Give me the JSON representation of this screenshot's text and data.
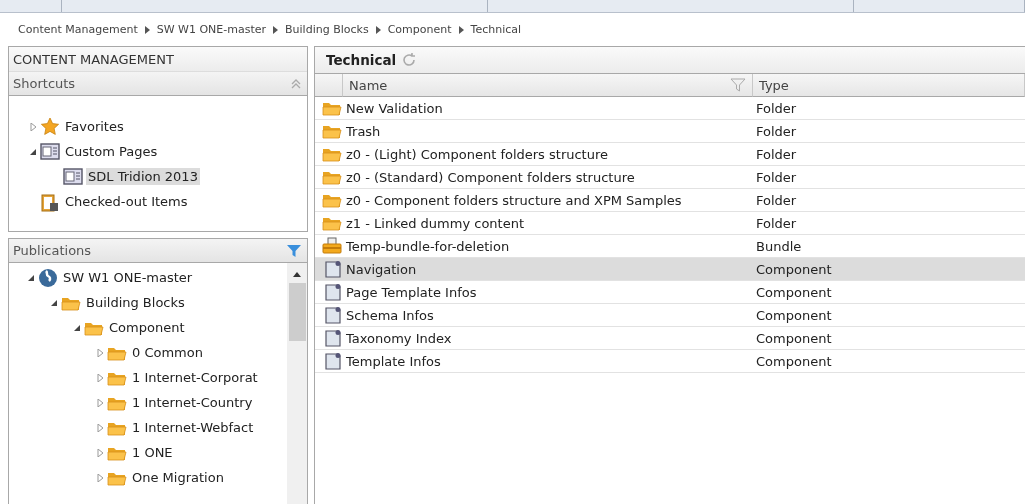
{
  "breadcrumb": [
    "Content Management",
    "SW W1 ONE-master",
    "Building Blocks",
    "Component",
    "Technical"
  ],
  "sidebar": {
    "title": "CONTENT MANAGEMENT",
    "shortcuts": {
      "title": "Shortcuts",
      "items": [
        {
          "label": "Favorites",
          "kind": "star",
          "expanded": false,
          "selected": false
        },
        {
          "label": "Custom Pages",
          "kind": "page",
          "expanded": true,
          "selected": false,
          "children": [
            {
              "label": "SDL Tridion 2013",
              "kind": "page",
              "selected": true
            }
          ]
        },
        {
          "label": "Checked-out Items",
          "kind": "checkout",
          "selected": false
        }
      ]
    },
    "publications": {
      "title": "Publications",
      "items": [
        {
          "label": "SW W1 ONE-master",
          "kind": "globe",
          "expanded": true,
          "children": [
            {
              "label": "Building Blocks",
              "kind": "folder",
              "expanded": true,
              "children": [
                {
                  "label": "Component",
                  "kind": "folder",
                  "expanded": true,
                  "children": [
                    {
                      "label": "0 Common",
                      "kind": "folder",
                      "expanded": false
                    },
                    {
                      "label": "1 Internet-Corporat",
                      "kind": "folder",
                      "expanded": false
                    },
                    {
                      "label": "1 Internet-Country",
                      "kind": "folder",
                      "expanded": false
                    },
                    {
                      "label": "1 Internet-Webfact",
                      "kind": "folder",
                      "expanded": false
                    },
                    {
                      "label": "1 ONE",
                      "kind": "folder",
                      "expanded": false
                    },
                    {
                      "label": "One Migration",
                      "kind": "folder",
                      "expanded": false
                    }
                  ]
                }
              ]
            }
          ]
        }
      ]
    }
  },
  "main": {
    "title": "Technical",
    "table": {
      "columns": [
        "Name",
        "Type"
      ],
      "rows": [
        {
          "kind": "folder",
          "name": "New Validation",
          "type": "Folder",
          "selected": false
        },
        {
          "kind": "folder",
          "name": "Trash",
          "type": "Folder",
          "selected": false
        },
        {
          "kind": "folder",
          "name": "z0 - (Light) Component folders structure",
          "type": "Folder",
          "selected": false
        },
        {
          "kind": "folder",
          "name": "z0 - (Standard) Component folders structure",
          "type": "Folder",
          "selected": false
        },
        {
          "kind": "folder",
          "name": "z0 - Component folders structure and XPM Samples",
          "type": "Folder",
          "selected": false
        },
        {
          "kind": "folder",
          "name": "z1 - Linked dummy content",
          "type": "Folder",
          "selected": false
        },
        {
          "kind": "bundle",
          "name": "Temp-bundle-for-deletion",
          "type": "Bundle",
          "selected": false
        },
        {
          "kind": "component",
          "name": "Navigation",
          "type": "Component",
          "selected": true
        },
        {
          "kind": "component",
          "name": "Page Template Infos",
          "type": "Component",
          "selected": false
        },
        {
          "kind": "component",
          "name": "Schema Infos",
          "type": "Component",
          "selected": false
        },
        {
          "kind": "component",
          "name": "Taxonomy Index",
          "type": "Component",
          "selected": false
        },
        {
          "kind": "component",
          "name": "Template Infos",
          "type": "Component",
          "selected": false
        }
      ]
    }
  }
}
